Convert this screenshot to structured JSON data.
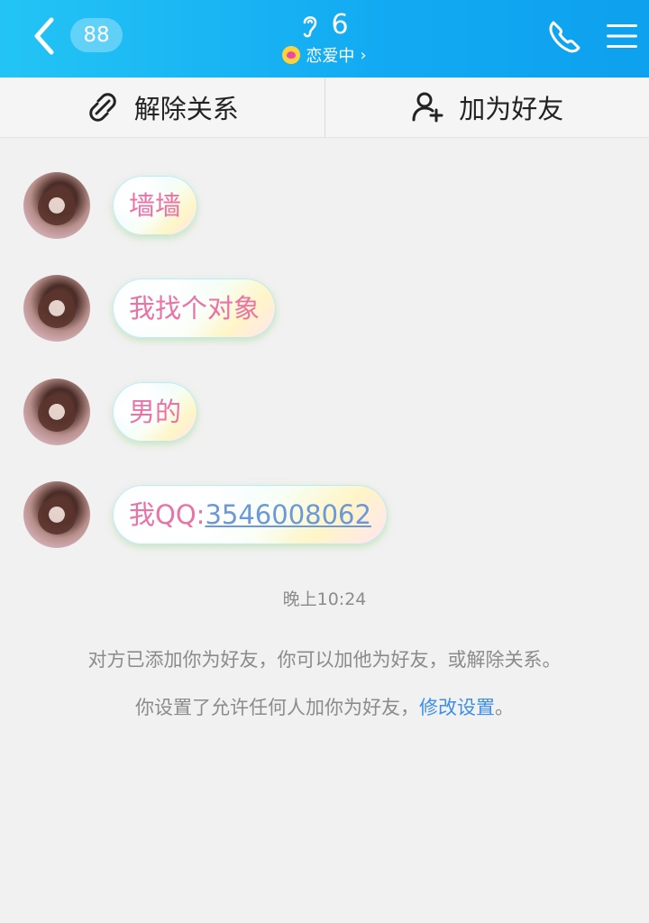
{
  "header": {
    "unread_count": "88",
    "title": "6",
    "status": "恋爱中",
    "status_chevron": "›"
  },
  "actions": {
    "unlink": "解除关系",
    "add_friend": "加为好友"
  },
  "messages": [
    {
      "text": "墙墙"
    },
    {
      "text": "我找个对象"
    },
    {
      "text": "男的"
    },
    {
      "prefix": "我QQ:",
      "link": "3546008062"
    }
  ],
  "system": {
    "timestamp": "晚上10:24",
    "notice_line1": "对方已添加你为好友，你可以加他为好友，或解除关系。",
    "notice_line2_prefix": "你设置了允许任何人加你为好友，",
    "notice_line2_link": "修改设置",
    "notice_line2_suffix": "。"
  },
  "colors": {
    "header_gradient_start": "#23c4f5",
    "header_gradient_end": "#0ea1ee",
    "bubble_text": "#ea72a6",
    "link": "#3c8ee8",
    "qq_link": "#6a98d8",
    "system_text": "#8b8b8b"
  },
  "icons": {
    "back": "chevron-left-icon",
    "ear": "ear-icon",
    "phone": "phone-icon",
    "menu": "menu-icon",
    "unlink": "unlink-icon",
    "add_user": "add-user-icon"
  }
}
